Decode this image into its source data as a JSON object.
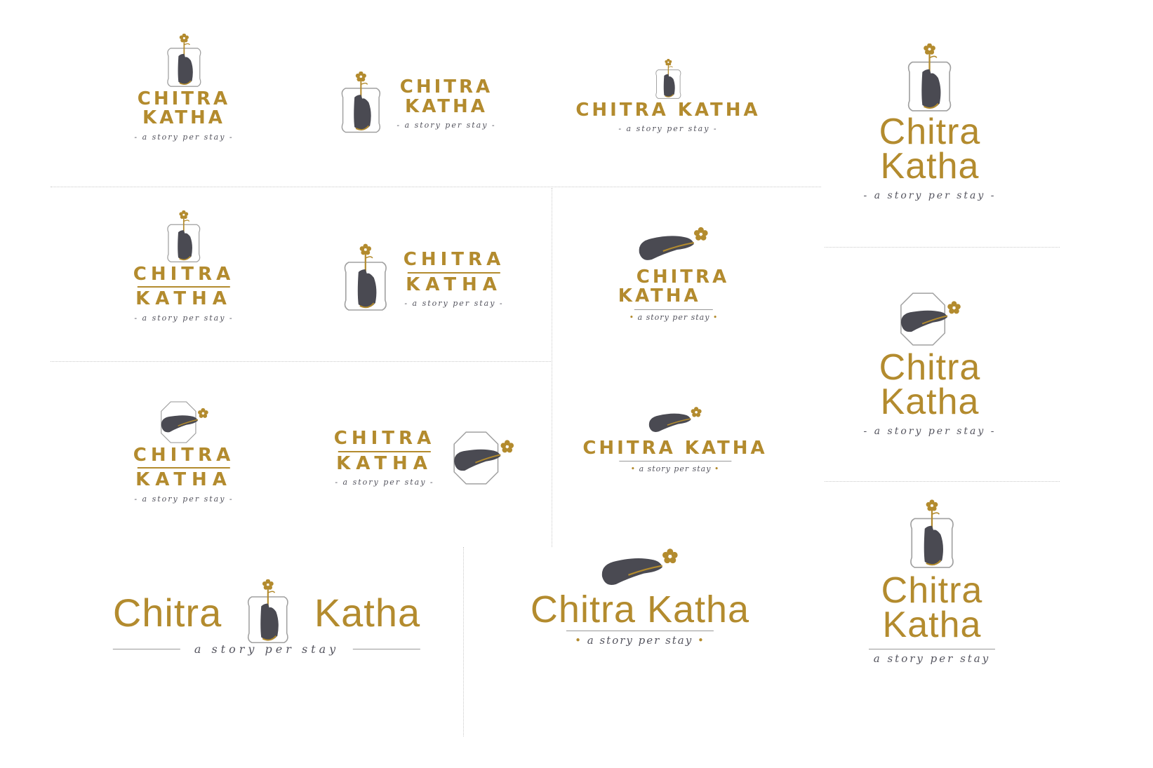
{
  "brand": {
    "line1_caps": "CHITRA",
    "line2_caps": "KATHA",
    "line1_script": "Chitra",
    "line2_script": "Katha",
    "single_caps": "CHITRA KATHA",
    "single_script": "Chitra Katha",
    "tag_dashed": "- a story per stay -",
    "tag_dotted": "a story per stay",
    "tag_plain": "a story per stay"
  },
  "colors": {
    "gold": "#b38b2e",
    "charcoal": "#4a4a52",
    "frame": "#a0a0a0",
    "background": "#ffffff"
  },
  "icons": [
    "hand-flower-frame-icon",
    "hand-offering-flower-icon",
    "hand-flower-octagon-icon"
  ]
}
